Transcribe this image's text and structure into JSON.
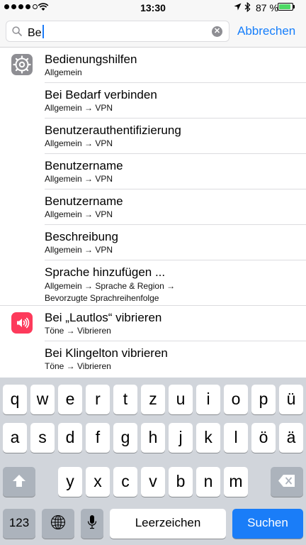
{
  "status_bar": {
    "time": "13:30",
    "battery_percent": "87 %",
    "battery_level": 0.87,
    "signal_dots_filled": 4,
    "signal_dots_total": 5,
    "battery_color": "#4cd964"
  },
  "search": {
    "query": "Be",
    "cancel_label": "Abbrechen",
    "accent_color": "#157efb"
  },
  "results": [
    {
      "title": "Bedienungshilfen",
      "path": "Allgemein",
      "icon": "gear-icon"
    },
    {
      "title": "Bei Bedarf verbinden",
      "path": "Allgemein → VPN"
    },
    {
      "title": "Benutzerauthentifizierung",
      "path": "Allgemein → VPN"
    },
    {
      "title": "Benutzername",
      "path": "Allgemein → VPN"
    },
    {
      "title": "Benutzername",
      "path": "Allgemein → VPN"
    },
    {
      "title": "Beschreibung",
      "path": "Allgemein → VPN"
    },
    {
      "title": "Sprache hinzufügen ...",
      "path_line1": "Allgemein → Sprache & Region →",
      "path_line2": "Bevorzugte Sprachreihenfolge"
    },
    {
      "title": "Bei „Lautlos“ vibrieren",
      "path": "Töne → Vibrieren",
      "icon": "speaker-icon"
    },
    {
      "title": "Bei Klingelton vibrieren",
      "path": "Töne → Vibrieren"
    }
  ],
  "keyboard": {
    "row1": [
      "q",
      "w",
      "e",
      "r",
      "t",
      "z",
      "u",
      "i",
      "o",
      "p",
      "ü"
    ],
    "row2": [
      "a",
      "s",
      "d",
      "f",
      "g",
      "h",
      "j",
      "k",
      "l",
      "ö",
      "ä"
    ],
    "row3": [
      "y",
      "x",
      "c",
      "v",
      "b",
      "n",
      "m"
    ],
    "numbers_label": "123",
    "space_label": "Leerzeichen",
    "search_label": "Suchen"
  }
}
